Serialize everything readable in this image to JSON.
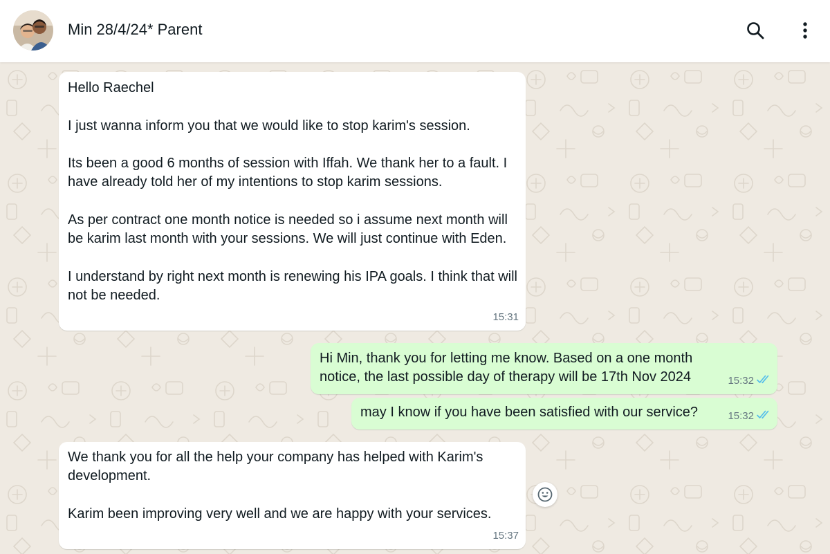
{
  "header": {
    "title": "Min 28/4/24* Parent",
    "avatar_icon": "contact-avatar",
    "search_icon": "search-icon",
    "menu_icon": "more-vertical-icon"
  },
  "colors": {
    "header_bg": "#ffffff",
    "wallpaper": "#efeae2",
    "incoming_bubble": "#ffffff",
    "outgoing_bubble": "#d9fdd3",
    "read_ticks": "#53bdeb"
  },
  "messages": [
    {
      "direction": "incoming",
      "text": "Hello Raechel\n\nI just wanna inform you that we would like to stop karim's session.\n\nIts been a good 6 months of session with Iffah. We thank her to a fault. I have already told her of my intentions to stop karim sessions.\n\nAs per contract one month notice is needed so i assume next month will be karim last month with your sessions. We will just continue with Eden.\n\nI understand by right next month is renewing his IPA goals. I think that will not be needed.",
      "time": "15:31"
    },
    {
      "direction": "outgoing",
      "text": "Hi Min, thank you for letting me know. Based on a one month notice, the last possible day of therapy will be 17th Nov 2024",
      "time": "15:32",
      "status_icon": "double-check-read-icon"
    },
    {
      "direction": "outgoing",
      "text": "may I know if you have been satisfied with our service?",
      "time": "15:32",
      "status_icon": "double-check-read-icon"
    },
    {
      "direction": "incoming",
      "text": "We thank you for all the help your company has helped with Karim's development.\n\nKarim been improving very well and we are happy with your services.",
      "time": "15:37"
    }
  ],
  "reaction_button_icon": "emoji-smile-icon"
}
